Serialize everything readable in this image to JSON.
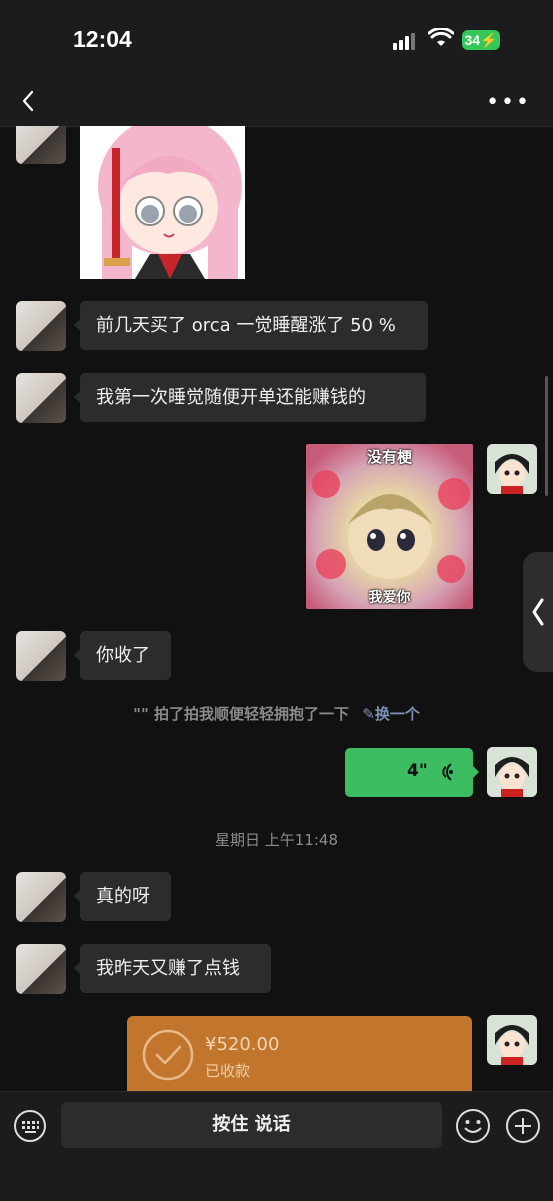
{
  "status_bar": {
    "time": "12:04",
    "battery": "34"
  },
  "nav": {
    "title": ""
  },
  "messages": [
    {
      "text": "前几天买了 orca 一觉睡醒涨了 50 %"
    },
    {
      "text": "我第一次睡觉随便开单还能赚钱的"
    },
    {
      "text": "你收了"
    },
    {
      "text": "真的呀"
    },
    {
      "text": "我昨天又赚了点钱"
    }
  ],
  "sticker_left": {
    "description": "pink-hair-anime-girl-sticker"
  },
  "sticker_right": {
    "top_text": "没有梗",
    "bottom_text": "我爱你"
  },
  "pat": {
    "text": "\"\" 拍了拍我顺便轻轻拥抱了一下",
    "action": "换一个"
  },
  "voice": {
    "duration": "4\""
  },
  "timestamp": "星期日 上午11:48",
  "transfer": {
    "amount": "¥520.00",
    "status": "已收款"
  },
  "input": {
    "talk_label": "按住 说话"
  },
  "colors": {
    "accent_green": "#3dbd62",
    "transfer_orange": "#c2762d",
    "background": "#111111"
  }
}
